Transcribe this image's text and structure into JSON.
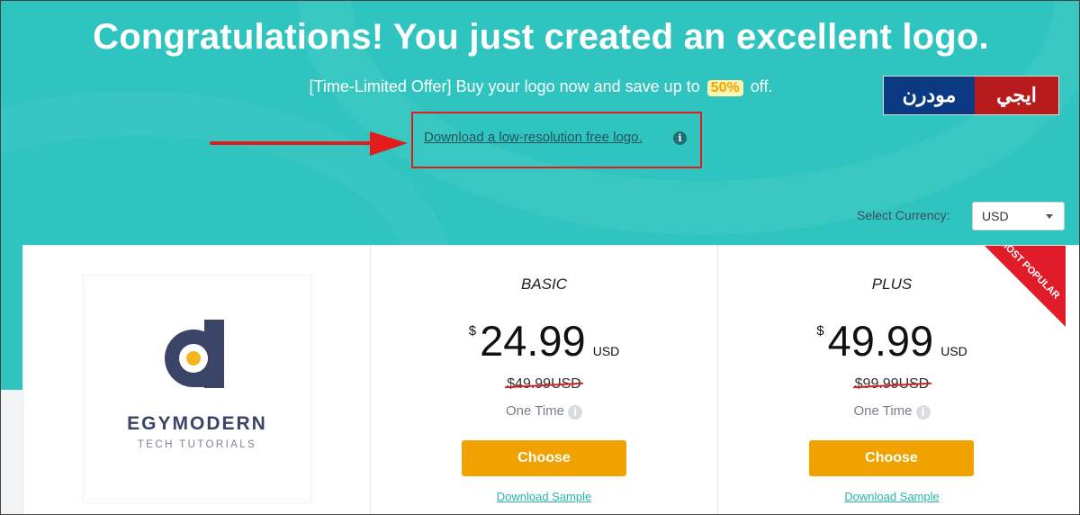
{
  "header": {
    "title": "Congratulations! You just created an excellent logo.",
    "offer_prefix": "[Time-Limited Offer] Buy your logo now and save up to",
    "offer_percent": "50%",
    "offer_suffix": "off.",
    "download_free_link": "Download a low-resolution free logo.",
    "info_icon_glyph": "i"
  },
  "watermark": {
    "left_text": "مودرن",
    "right_text": "ايجي"
  },
  "currency": {
    "label": "Select Currency:",
    "selected": "USD"
  },
  "logo_preview": {
    "brand_name": "EGYMODERN",
    "tagline": "TECH TUTORIALS",
    "colors": {
      "navy": "#3a4466",
      "accent": "#f5b61d"
    }
  },
  "plans": [
    {
      "name": "BASIC",
      "currency_symbol": "$",
      "price": "24.99",
      "price_code": "USD",
      "old_price": "$49.99USD",
      "billing": "One Time",
      "choose_label": "Choose",
      "sample_link": "Download Sample"
    },
    {
      "name": "PLUS",
      "currency_symbol": "$",
      "price": "49.99",
      "price_code": "USD",
      "old_price": "$99.99USD",
      "billing": "One Time",
      "choose_label": "Choose",
      "sample_link": "Download Sample",
      "ribbon": "MOST POPULAR"
    }
  ],
  "colors": {
    "hero_bg": "#2fc4bf",
    "button": "#f0a300",
    "ribbon": "#e11c2a",
    "highlight_box": "#e31b1b"
  }
}
